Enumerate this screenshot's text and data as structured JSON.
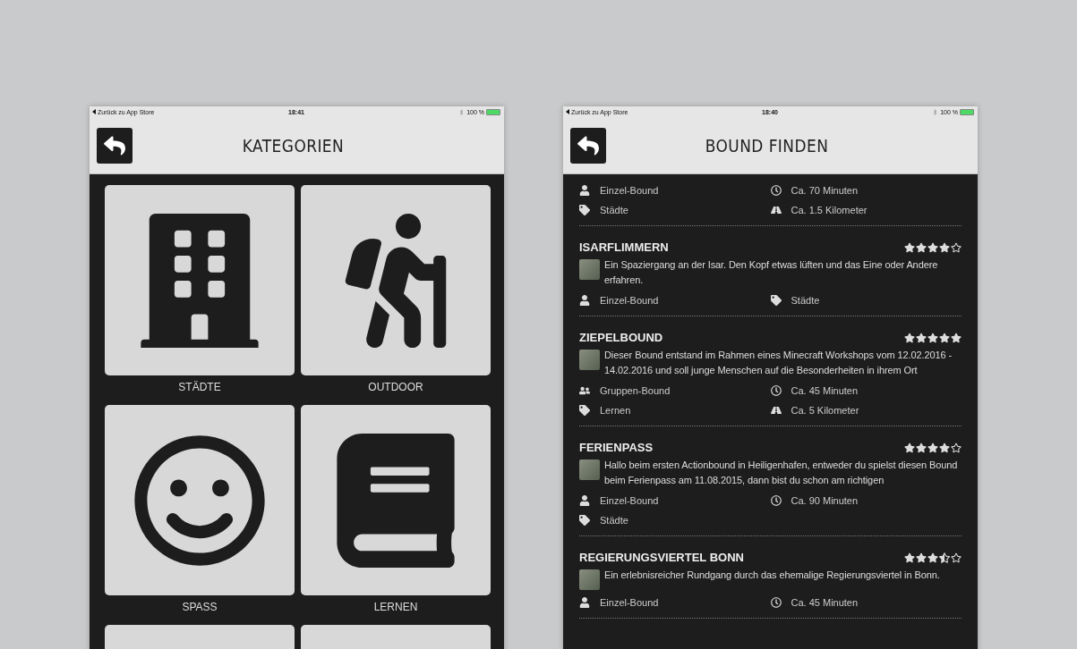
{
  "screens": [
    {
      "status": {
        "back": "Zurück zu App Store",
        "time": "18:41",
        "battery": "100 %"
      },
      "title": "KATEGORIEN",
      "categories": [
        {
          "kind": "city",
          "label": "STÄDTE"
        },
        {
          "kind": "hiker",
          "label": "OUTDOOR"
        },
        {
          "kind": "smiley",
          "label": "SPASS"
        },
        {
          "kind": "book",
          "label": "LERNEN"
        },
        {
          "kind": "blank"
        },
        {
          "kind": "blank"
        }
      ]
    },
    {
      "status": {
        "back": "Zurück zu App Store",
        "time": "18:40",
        "battery": "100 %"
      },
      "title": "BOUND FINDEN",
      "bounds": [
        {
          "meta": [
            {
              "kind": "single",
              "text": "Einzel-Bound"
            },
            {
              "kind": "duration",
              "text": "Ca. 70 Minuten"
            },
            {
              "kind": "category",
              "text": "Städte"
            },
            {
              "kind": "distance",
              "text": "Ca. 1.5 Kilometer"
            }
          ]
        },
        {
          "name": "ISARFLIMMERN",
          "stars": 4,
          "description": "Ein Spaziergang an der Isar. Den Kopf etwas lüften und das Eine oder Andere erfahren.",
          "meta": [
            {
              "kind": "single",
              "text": "Einzel-Bound"
            },
            {
              "kind": "category",
              "text": "Städte"
            }
          ]
        },
        {
          "name": "ZIEPELBOUND",
          "stars": 5,
          "description": "Dieser Bound entstand im Rahmen eines Minecraft Workshops vom 12.02.2016 - 14.02.2016 und soll junge Menschen auf die Besonderheiten in ihrem Ort",
          "meta": [
            {
              "kind": "group",
              "text": "Gruppen-Bound"
            },
            {
              "kind": "duration",
              "text": "Ca. 45 Minuten"
            },
            {
              "kind": "category",
              "text": "Lernen"
            },
            {
              "kind": "distance",
              "text": "Ca. 5 Kilometer"
            }
          ]
        },
        {
          "name": "FERIENPASS",
          "stars": 4,
          "description": "Hallo beim ersten Actionbound in Heiligenhafen, entweder du spielst diesen Bound beim Ferienpass am 11.08.2015, dann bist du schon am richtigen",
          "meta": [
            {
              "kind": "single",
              "text": "Einzel-Bound"
            },
            {
              "kind": "duration",
              "text": "Ca. 90 Minuten"
            },
            {
              "kind": "category",
              "text": "Städte"
            }
          ]
        },
        {
          "name": "REGIERUNGSVIERTEL BONN",
          "stars": 3.5,
          "description": "Ein erlebnisreicher Rundgang durch das ehemalige Regierungsviertel in Bonn.",
          "meta": [
            {
              "kind": "single",
              "text": "Einzel-Bound"
            },
            {
              "kind": "duration",
              "text": "Ca. 45 Minuten"
            }
          ]
        }
      ]
    }
  ]
}
